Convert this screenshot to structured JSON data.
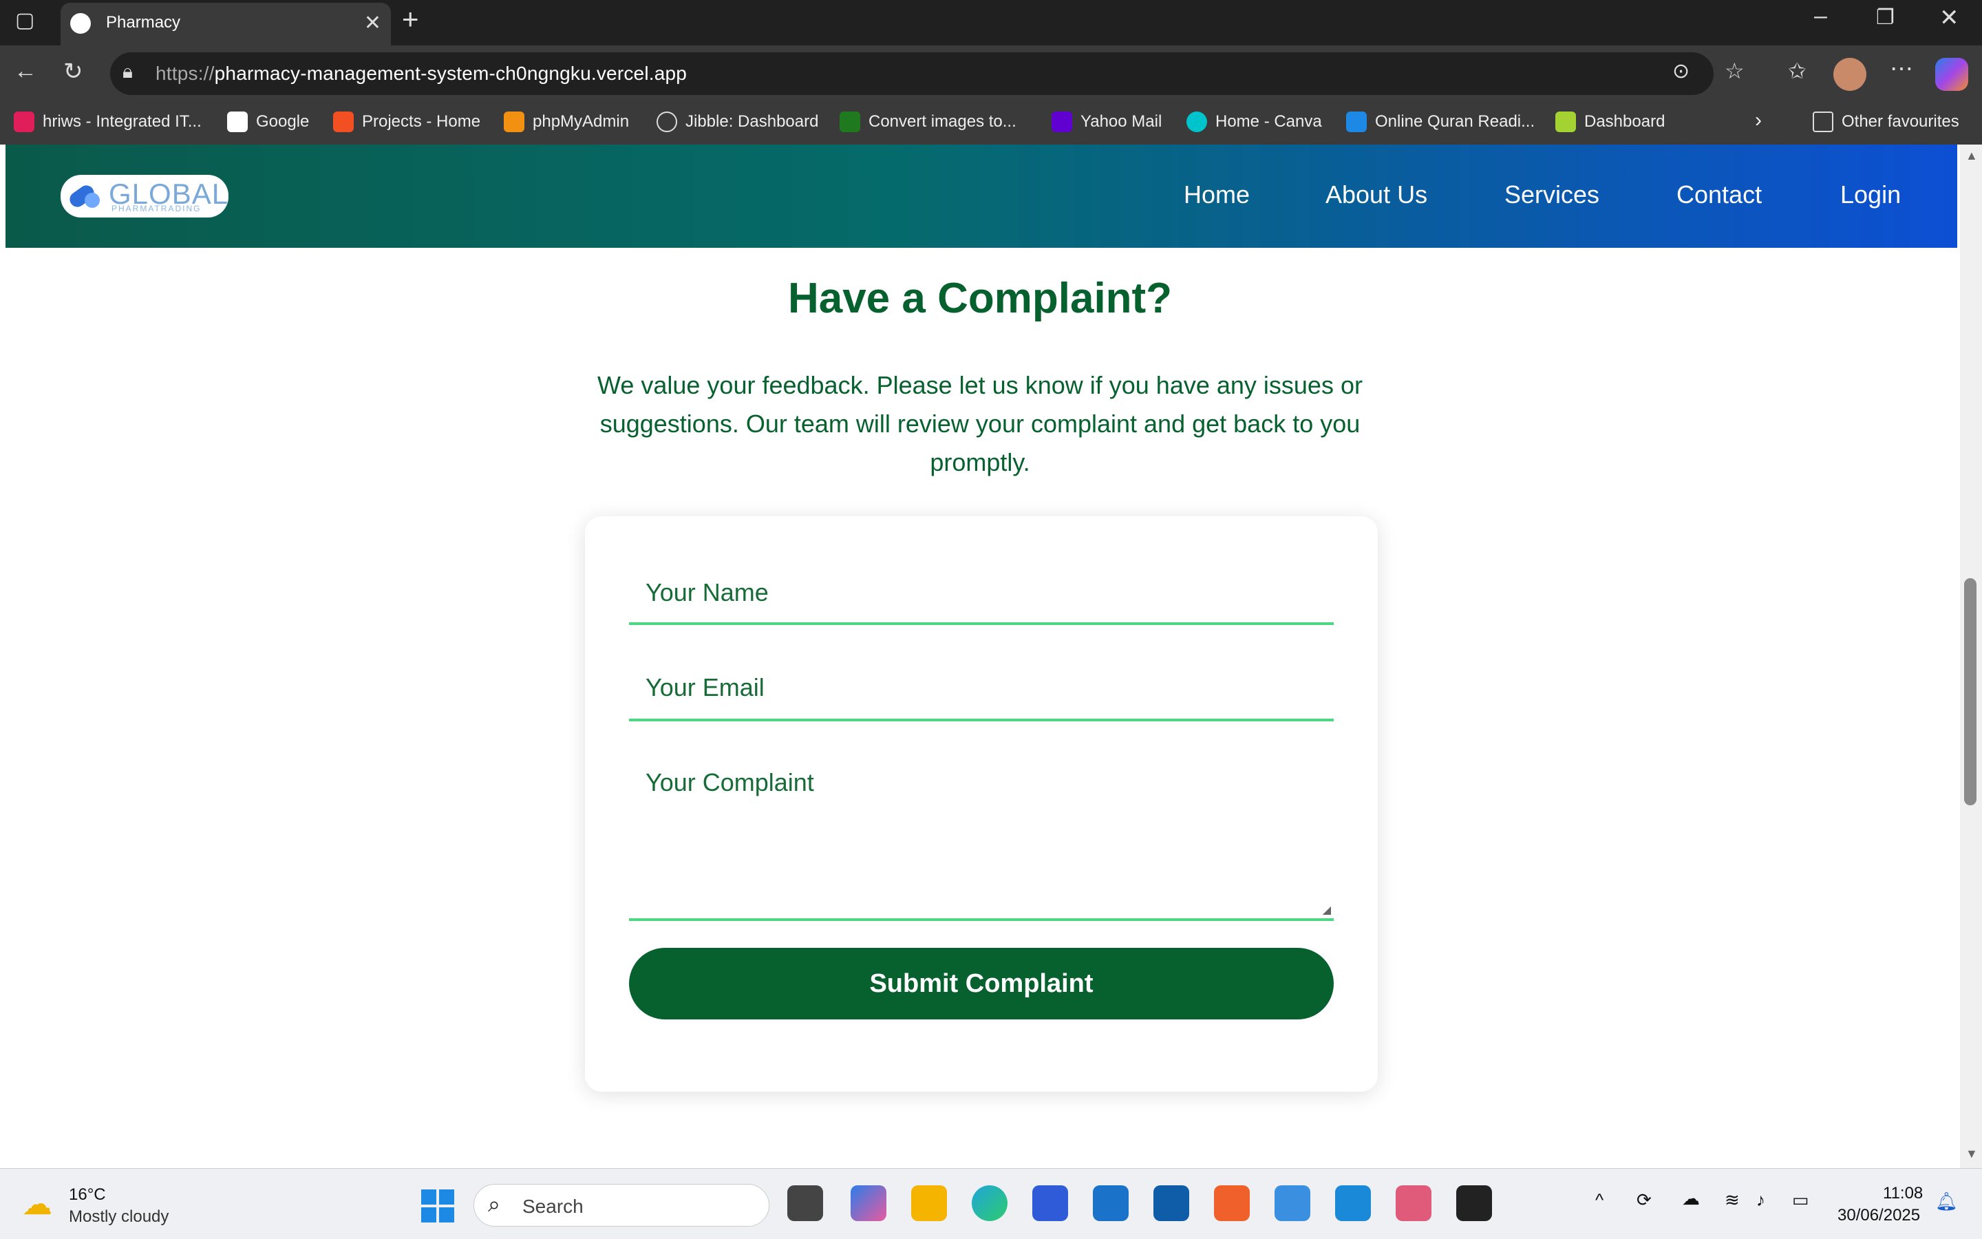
{
  "browser": {
    "tab_title": "Pharmacy",
    "url_prefix": "https://",
    "url_host": "pharmacy-management-system-ch0ngngku.vercel.app",
    "bookmarks": [
      {
        "label": "hriws - Integrated IT...",
        "color": "#e01e5a"
      },
      {
        "label": "Google",
        "color": "#ffffff"
      },
      {
        "label": "Projects - Home",
        "color": "#f25022"
      },
      {
        "label": "phpMyAdmin",
        "color": "#f29111"
      },
      {
        "label": "Jibble: Dashboard",
        "color": "#3a3a3a"
      },
      {
        "label": "Convert images to...",
        "color": "#1f7a1f"
      },
      {
        "label": "Yahoo Mail",
        "color": "#6001d2"
      },
      {
        "label": "Home - Canva",
        "color": "#00c4cc"
      },
      {
        "label": "Online Quran Readi...",
        "color": "#1e88e5"
      },
      {
        "label": "Dashboard",
        "color": "#a4d233"
      }
    ],
    "other_favourites": "Other favourites"
  },
  "site": {
    "logo_text": "GLOBAL",
    "logo_sub": "PHARMATRADING",
    "nav": [
      "Home",
      "About Us",
      "Services",
      "Contact",
      "Login"
    ]
  },
  "main": {
    "heading": "Have a Complaint?",
    "intro": "We value your feedback. Please let us know if you have any issues or suggestions. Our team will review your complaint and get back to you promptly.",
    "form": {
      "name_placeholder": "Your Name",
      "email_placeholder": "Your Email",
      "complaint_placeholder": "Your Complaint",
      "submit_label": "Submit Complaint"
    }
  },
  "taskbar": {
    "weather_temp": "16°C",
    "weather_desc": "Mostly cloudy",
    "search_placeholder": "Search",
    "time": "11:08",
    "date": "30/06/2025"
  },
  "colors": {
    "brand_green": "#07612f",
    "field_underline": "#4fd884",
    "header_gradient_start": "#0a5a4a",
    "header_gradient_end": "#0d4fd4"
  }
}
